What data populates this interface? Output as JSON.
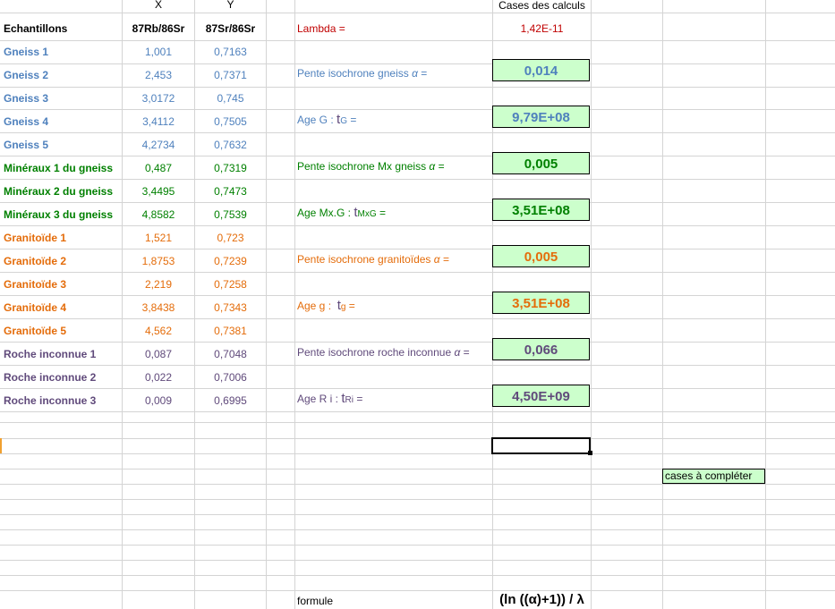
{
  "colors": {
    "gneiss": "#4f81bd",
    "mineraux": "#008000",
    "granitoide": "#e46c0a",
    "roche": "#604a7b",
    "lambda": "#c00000",
    "result_bg": "#ccffcc"
  },
  "header": {
    "x": "X",
    "y": "Y",
    "cases_calculs": "Cases des calculs"
  },
  "columns": {
    "echantillons": "Echantillons",
    "rb": "87Rb/86Sr",
    "sr": "87Sr/86Sr"
  },
  "samples": [
    {
      "name": "Gneiss 1",
      "x": "1,001",
      "y": "0,7163"
    },
    {
      "name": "Gneiss 2",
      "x": "2,453",
      "y": "0,7371"
    },
    {
      "name": "Gneiss 3",
      "x": "3,0172",
      "y": "0,745"
    },
    {
      "name": "Gneiss 4",
      "x": "3,4112",
      "y": "0,7505"
    },
    {
      "name": "Gneiss 5",
      "x": "4,2734",
      "y": "0,7632"
    },
    {
      "name": "Minéraux 1 du gneiss",
      "x": "0,487",
      "y": "0,7319"
    },
    {
      "name": "Minéraux 2 du gneiss",
      "x": "3,4495",
      "y": "0,7473"
    },
    {
      "name": "Minéraux 3 du gneiss",
      "x": "4,8582",
      "y": "0,7539"
    },
    {
      "name": "Granitoïde 1",
      "x": "1,521",
      "y": "0,723"
    },
    {
      "name": "Granitoïde 2",
      "x": "1,8753",
      "y": "0,7239"
    },
    {
      "name": "Granitoïde 3",
      "x": "2,219",
      "y": "0,7258"
    },
    {
      "name": "Granitoïde 4",
      "x": "3,8438",
      "y": "0,7343"
    },
    {
      "name": "Granitoïde 5",
      "x": "4,562",
      "y": "0,7381"
    },
    {
      "name": "Roche inconnue 1",
      "x": "0,087",
      "y": "0,7048"
    },
    {
      "name": "Roche inconnue 2",
      "x": "0,022",
      "y": "0,7006"
    },
    {
      "name": "Roche inconnue 3",
      "x": "0,009",
      "y": "0,6995"
    }
  ],
  "lambda": {
    "label": "Lambda =",
    "value": "1,42E-11"
  },
  "calc": {
    "pente_gneiss": "Pente isochrone gneiss",
    "pente_gneiss_value": "0,014",
    "age_g_label": "Age G :",
    "age_g_t": "t",
    "age_g_sub": "G",
    "age_g_value": "9,79E+08",
    "pente_mx": "Pente isochrone Mx gneiss",
    "pente_mx_value": "0,005",
    "age_mx_label": "Age Mx.G :",
    "age_mx_t": "t",
    "age_mx_sub": "MxG",
    "age_mx_value": "3,51E+08",
    "pente_gr": "Pente isochrone granitoïdes",
    "pente_gr_value": "0,005",
    "age_gr_label": "Age g :",
    "age_gr_t": "t",
    "age_gr_sub": "g",
    "age_gr_value": "3,51E+08",
    "pente_ri": "Pente isochrone roche inconnue",
    "pente_ri_value": "0,066",
    "age_ri_label": "Age  R i :",
    "age_ri_t": "t",
    "age_ri_sub": "Ri",
    "age_ri_value": "4,50E+09",
    "alpha": "α",
    "equals": "="
  },
  "legend": "cases à compléter",
  "formule_label": "formule",
  "formule_value": "(ln ((α)+1)) / λ"
}
